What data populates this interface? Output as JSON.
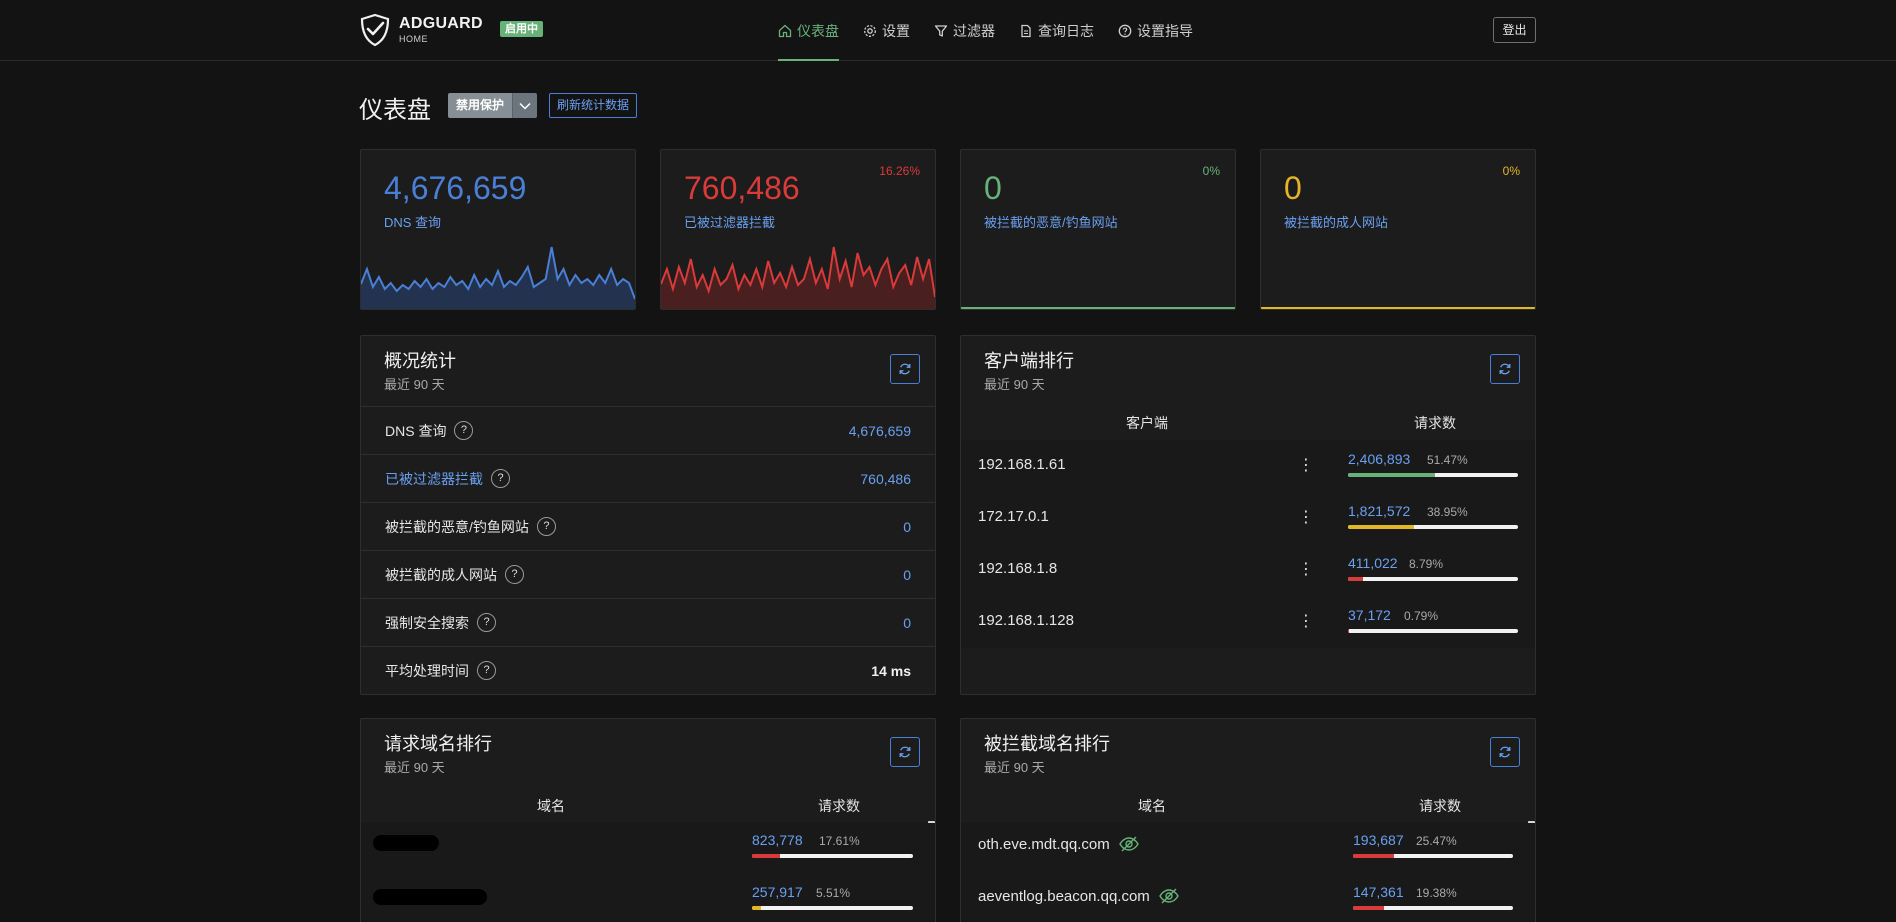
{
  "header": {
    "brand": "ADGUARD",
    "brand_sub": "HOME",
    "status_badge": "启用中",
    "nav": [
      {
        "label": "仪表盘",
        "icon": "home-icon",
        "active": true
      },
      {
        "label": "设置",
        "icon": "gear-icon",
        "active": false
      },
      {
        "label": "过滤器",
        "icon": "filter-icon",
        "active": false
      },
      {
        "label": "查询日志",
        "icon": "document-icon",
        "active": false
      },
      {
        "label": "设置指导",
        "icon": "help-circle-icon",
        "active": false
      }
    ],
    "logout_label": "登出"
  },
  "page": {
    "title": "仪表盘",
    "disable_protection_label": "禁用保护",
    "refresh_stats_label": "刷新统计数据"
  },
  "stat_cards": [
    {
      "value": "4,676,659",
      "label": "DNS 查询",
      "percent": "",
      "color": "#4a7fd6"
    },
    {
      "value": "760,486",
      "label": "已被过滤器拦截",
      "percent": "16.26%",
      "color": "#d93a3a"
    },
    {
      "value": "0",
      "label": "被拦截的恶意/钓鱼网站",
      "percent": "0%",
      "color": "#67b279"
    },
    {
      "value": "0",
      "label": "被拦截的成人网站",
      "percent": "0%",
      "color": "#e3b625"
    }
  ],
  "general_stats": {
    "title": "概况统计",
    "subtitle": "最近 90 天",
    "rows": [
      {
        "label": "DNS 查询",
        "value": "4,676,659"
      },
      {
        "label": "已被过滤器拦截",
        "value": "760,486"
      },
      {
        "label": "被拦截的恶意/钓鱼网站",
        "value": "0"
      },
      {
        "label": "被拦截的成人网站",
        "value": "0"
      },
      {
        "label": "强制安全搜索",
        "value": "0"
      },
      {
        "label": "平均处理时间",
        "value": "14 ms"
      }
    ]
  },
  "top_clients": {
    "title": "客户端排行",
    "subtitle": "最近 90 天",
    "col_client": "客户端",
    "col_requests": "请求数",
    "rows": [
      {
        "name": "192.168.1.61",
        "count": "2,406,893",
        "percent": "51.47%",
        "fraction": 0.5147,
        "color": "#67b279"
      },
      {
        "name": "172.17.0.1",
        "count": "1,821,572",
        "percent": "38.95%",
        "fraction": 0.3895,
        "color": "#e3b625"
      },
      {
        "name": "192.168.1.8",
        "count": "411,022",
        "percent": "8.79%",
        "fraction": 0.0879,
        "color": "#d93a3a"
      },
      {
        "name": "192.168.1.128",
        "count": "37,172",
        "percent": "0.79%",
        "fraction": 0.0079,
        "color": "#d93a3a"
      }
    ]
  },
  "top_domains": {
    "title": "请求域名排行",
    "subtitle": "最近 90 天",
    "col_domain": "域名",
    "col_requests": "请求数",
    "rows": [
      {
        "name": "",
        "count": "823,778",
        "percent": "17.61%",
        "fraction": 0.1761,
        "color": "#d93a3a"
      },
      {
        "name": "",
        "count": "257,917",
        "percent": "5.51%",
        "fraction": 0.0551,
        "color": "#e3b625"
      }
    ]
  },
  "top_blocked": {
    "title": "被拦截域名排行",
    "subtitle": "最近 90 天",
    "col_domain": "域名",
    "col_requests": "请求数",
    "rows": [
      {
        "name": "oth.eve.mdt.qq.com",
        "count": "193,687",
        "percent": "25.47%",
        "fraction": 0.2547,
        "color": "#d93a3a"
      },
      {
        "name": "aeventlog.beacon.qq.com",
        "count": "147,361",
        "percent": "19.38%",
        "fraction": 0.1938,
        "color": "#d93a3a"
      }
    ]
  }
}
